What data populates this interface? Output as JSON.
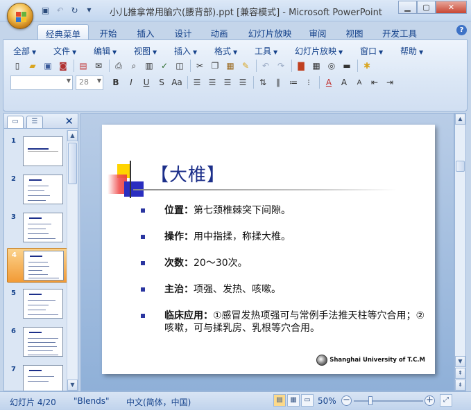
{
  "window": {
    "title": "小儿推拿常用腧穴(腰背部).ppt [兼容模式] - Microsoft PowerPoint"
  },
  "ribbon_tabs": [
    "经典菜单",
    "开始",
    "插入",
    "设计",
    "动画",
    "幻灯片放映",
    "审阅",
    "视图",
    "开发工具"
  ],
  "classic_menus": [
    "全部",
    "文件",
    "编辑",
    "视图",
    "插入",
    "格式",
    "工具",
    "幻灯片放映",
    "窗口",
    "帮助"
  ],
  "font_size_value": "28",
  "panel": {
    "slide_numbers": [
      "1",
      "2",
      "3",
      "4",
      "5",
      "6",
      "7"
    ],
    "selected_index": 4
  },
  "slide": {
    "title": "【大椎】",
    "bullets": [
      {
        "label": "位置：",
        "text": "第七颈椎棘突下间隙。"
      },
      {
        "label": "操作：",
        "text": "用中指揉，称揉大椎。"
      },
      {
        "label": "次数：",
        "text": "20～30次。"
      },
      {
        "label": "主治：",
        "text": "项强、发热、咳嗽。"
      },
      {
        "label": "临床应用：",
        "text": "①感冒发热项强可与常例手法推天柱等穴合用；②咳嗽，可与揉乳房、乳根等穴合用。"
      }
    ],
    "logo_text": "Shanghai University of T.C.M"
  },
  "status": {
    "slide_info": "幻灯片 4/20",
    "theme": "\"Blends\"",
    "language": "中文(简体，中国)",
    "zoom": "50%",
    "zoom_level": 0.5
  },
  "colors": {
    "slide_title": "#1c2f8a",
    "bullet": "#2a35a0",
    "selected_thumb": "#f29b36"
  }
}
